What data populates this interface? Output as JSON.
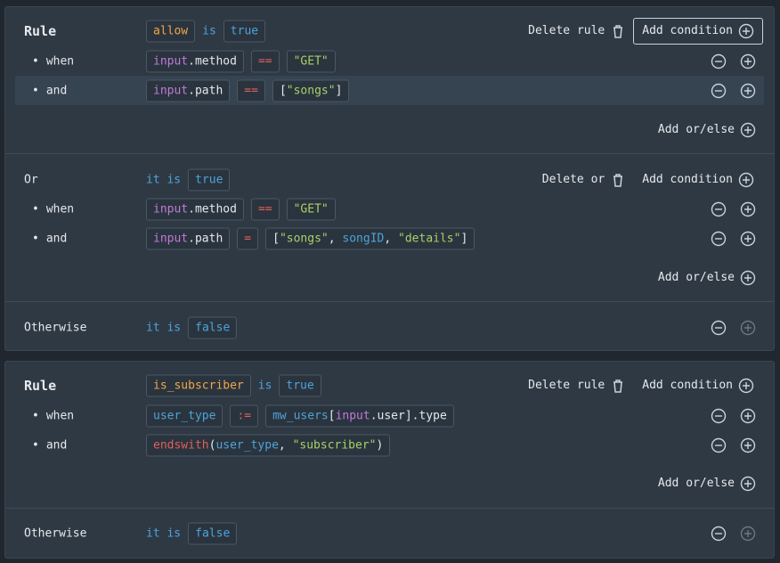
{
  "labels": {
    "rule": "Rule",
    "or": "Or",
    "otherwise": "Otherwise",
    "when": "when",
    "and": "and",
    "bullet": "•"
  },
  "actions": {
    "delete_rule": "Delete rule",
    "delete_or": "Delete or",
    "add_condition": "Add condition",
    "add_or_else": "Add or/else"
  },
  "tokens": {
    "is": "is",
    "it": "it",
    "true": "true",
    "false": "false",
    "allow": "allow",
    "is_subscriber": "is_subscriber",
    "input": "input",
    "method_suffix": ".method",
    "path_suffix": ".path",
    "eq": "==",
    "assign_eq": "=",
    "walrus": ":=",
    "get": "\"GET\"",
    "lbracket": "[",
    "rbracket": "]",
    "songs": "\"songs\"",
    "comma": ", ",
    "songID": "songID",
    "details": "\"details\"",
    "user_type": "user_type",
    "mw_users": "mw_users",
    "user_suffix": ".user",
    "type_suffix": ".type",
    "endswith": "endswith",
    "lparen": "(",
    "rparen": ")",
    "subscriber": "\"subscriber\""
  },
  "colors": {
    "background": "#20272e",
    "card": "#2e3944",
    "keyword": "#4fa3d9",
    "string": "#a8d06a",
    "operator": "#e0605a",
    "identifier": "#f0a64a",
    "builtin": "#c07ad8"
  }
}
